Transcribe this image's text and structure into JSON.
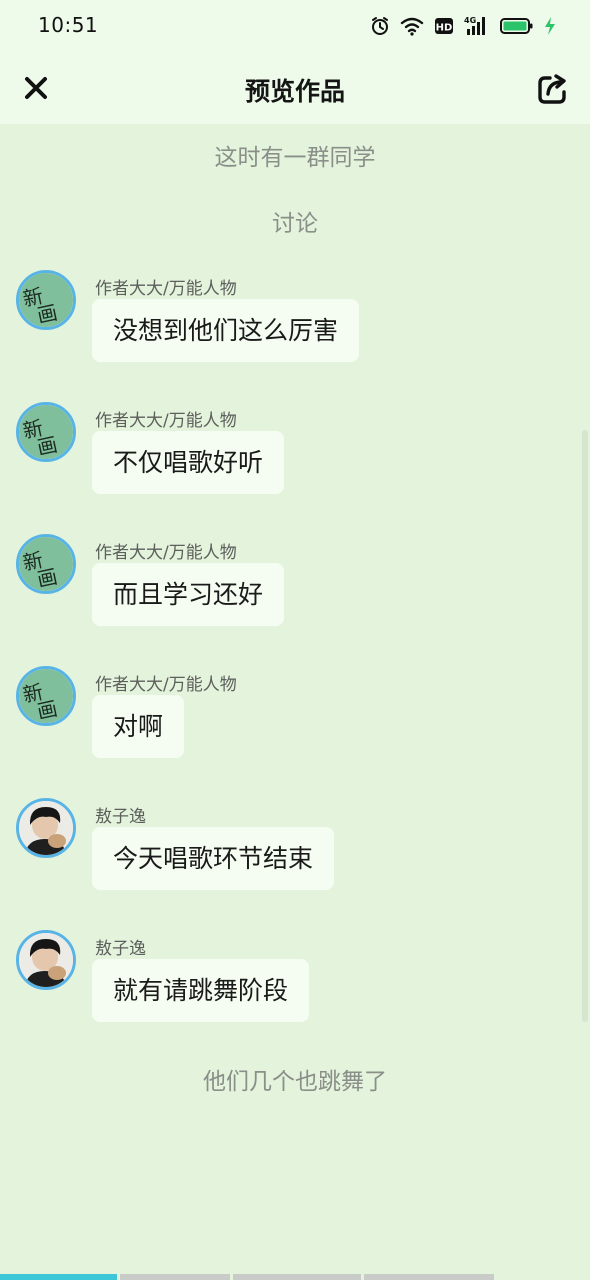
{
  "status_bar": {
    "time": "10:51",
    "icons": [
      "alarm-icon",
      "wifi-icon",
      "hd-icon",
      "signal-4g-icon",
      "battery-icon",
      "charging-icon"
    ],
    "hd_label": "HD",
    "network_label": "4G"
  },
  "header": {
    "title": "预览作品",
    "close_icon": "close-icon",
    "share_icon": "share-icon"
  },
  "narrations": [
    "这时有一群同学",
    "讨论",
    "他们几个也跳舞了"
  ],
  "messages": [
    {
      "sender": "作者大大/万能人物",
      "text": "没想到他们这么厉害",
      "avatar": "badge-avatar"
    },
    {
      "sender": "作者大大/万能人物",
      "text": "不仅唱歌好听",
      "avatar": "badge-avatar"
    },
    {
      "sender": "作者大大/万能人物",
      "text": "而且学习还好",
      "avatar": "badge-avatar"
    },
    {
      "sender": "作者大大/万能人物",
      "text": "对啊",
      "avatar": "badge-avatar"
    },
    {
      "sender": "敖子逸",
      "text": "今天唱歌环节结束",
      "avatar": "photo-avatar"
    },
    {
      "sender": "敖子逸",
      "text": "就有请跳舞阶段",
      "avatar": "photo-avatar"
    }
  ],
  "progress": {
    "segments": 4,
    "played_fraction_of_first_segment": 1.0
  },
  "colors": {
    "background": "#e3f3dc",
    "header_background": "#eefbea",
    "bubble": "#f5fdf2",
    "avatar_ring": "#58b4e6",
    "battery_green": "#2cc46a",
    "progress_active": "#3cc7d8"
  }
}
